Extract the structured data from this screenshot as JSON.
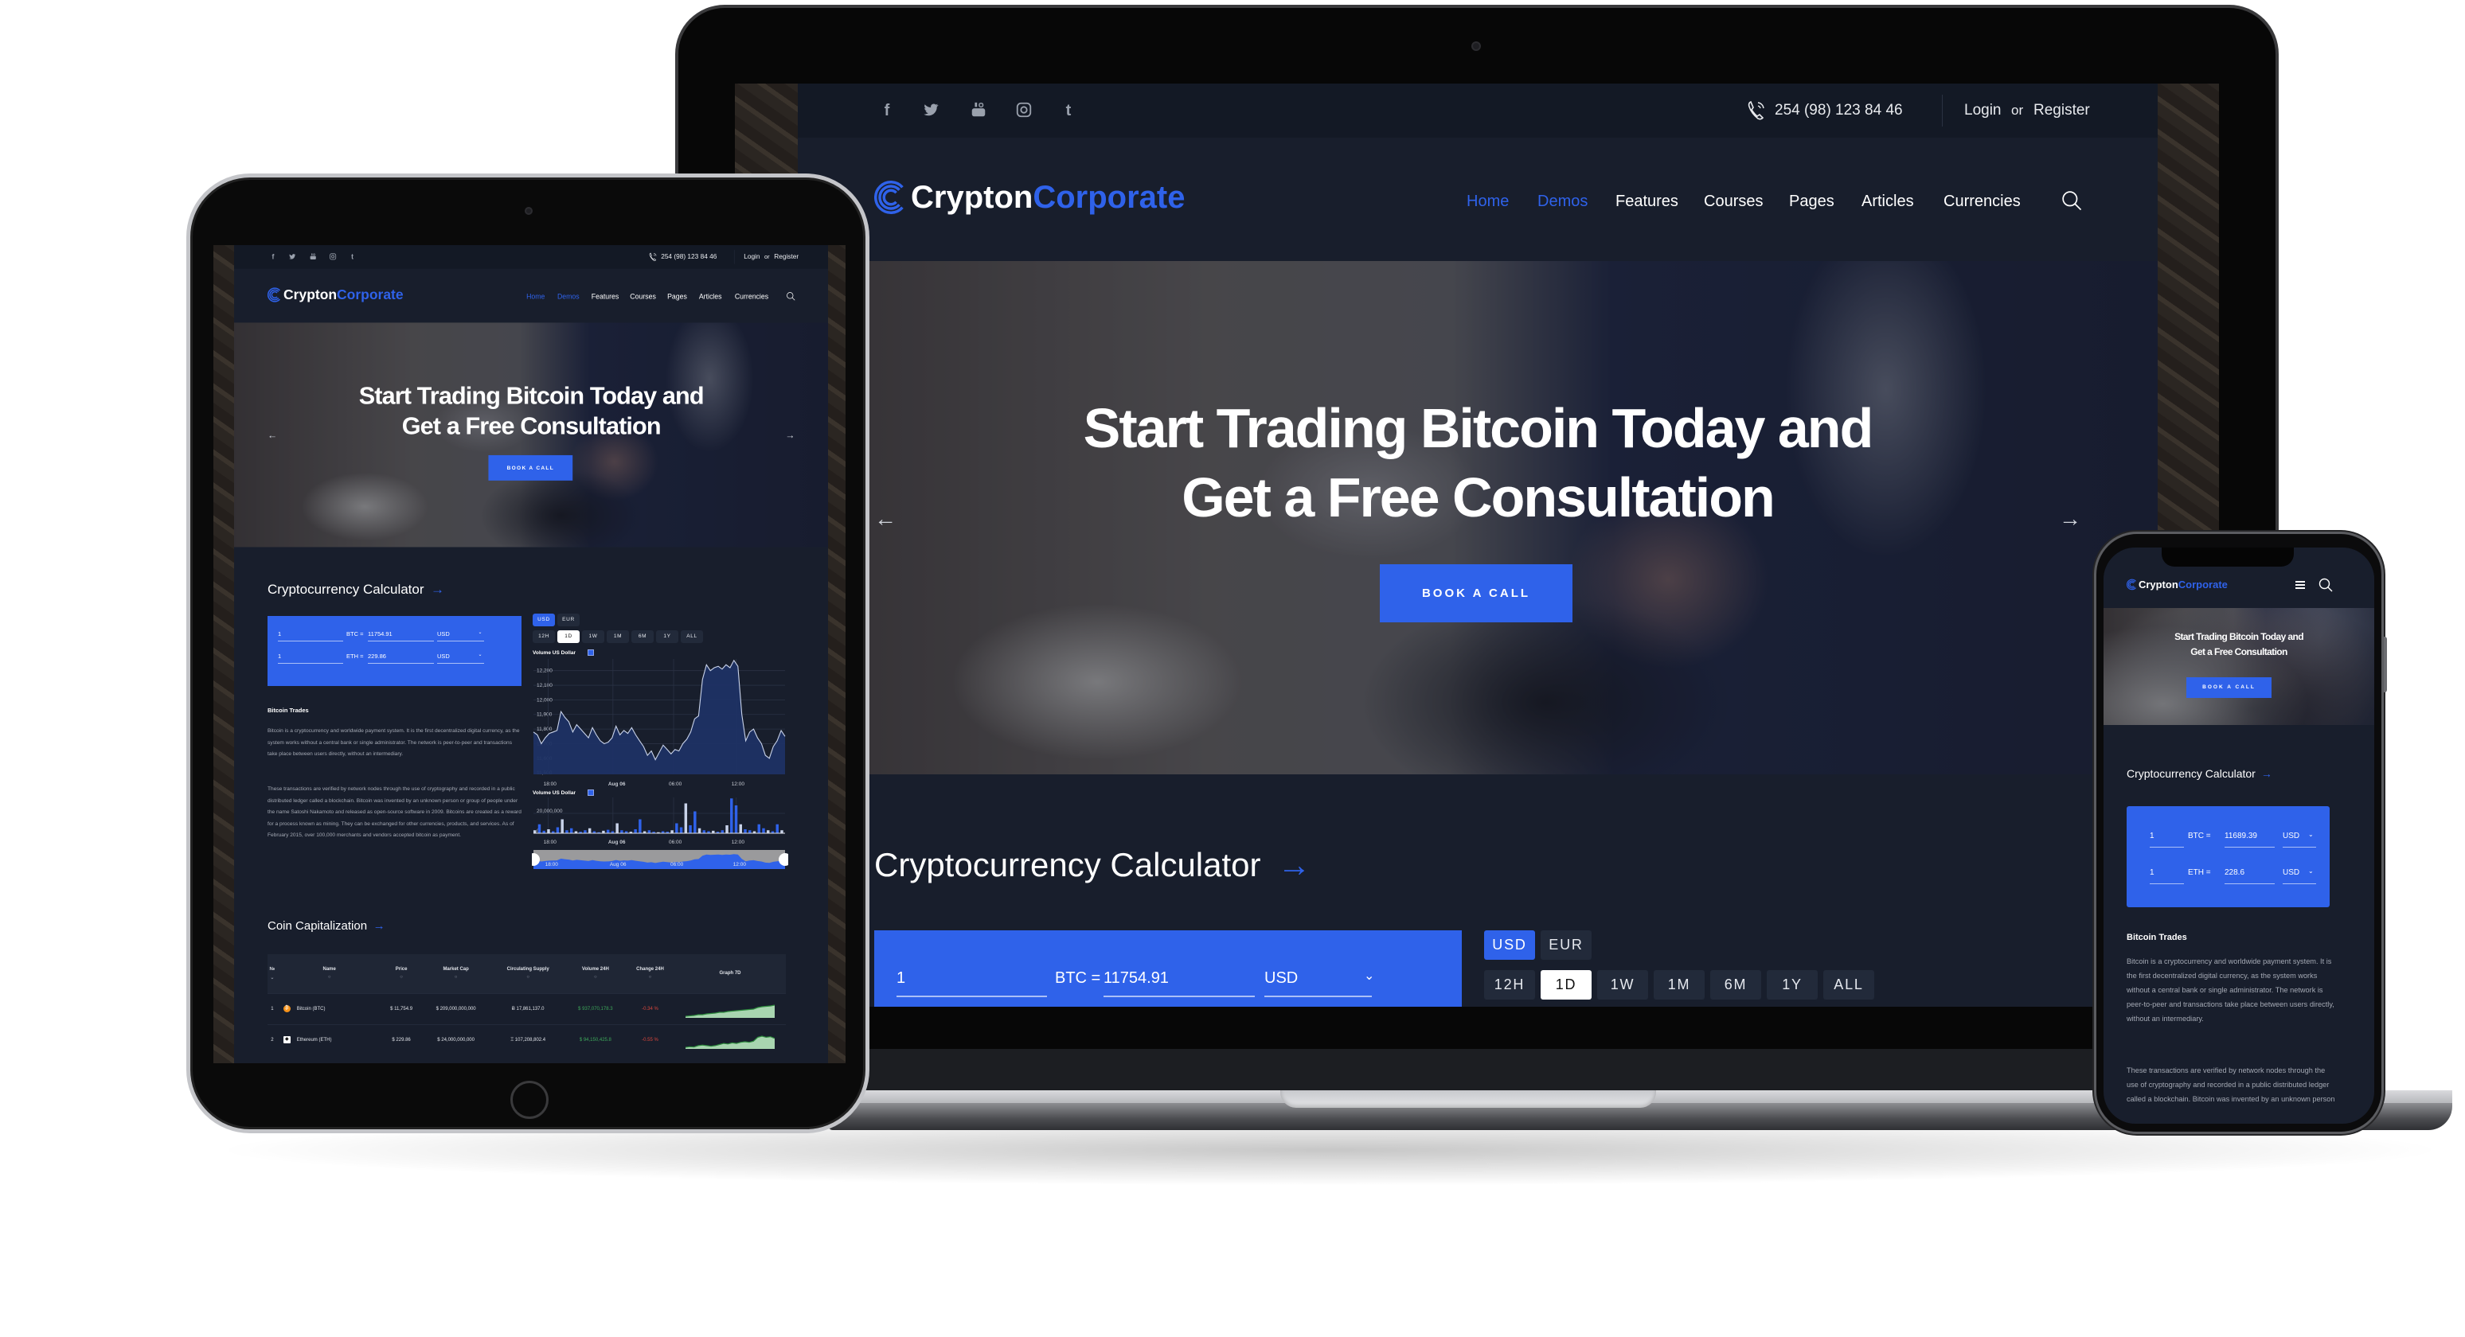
{
  "site": {
    "social": [
      "facebook-icon",
      "twitter-icon",
      "youtube-icon",
      "instagram-icon",
      "tumblr-icon"
    ],
    "phone": "254 (98) 123 84 46",
    "login": "Login",
    "or": "or",
    "register": "Register",
    "logo": {
      "part1": "Crypton",
      "part2": "Corporate"
    },
    "nav": [
      "Home",
      "Demos",
      "Features",
      "Courses",
      "Pages",
      "Articles",
      "Currencies"
    ],
    "nav_active": [
      "Home",
      "Demos"
    ],
    "hero": {
      "line1": "Start Trading Bitcoin Today and",
      "line2": "Get a Free Consultation",
      "button": "BOOK A CALL"
    },
    "calculator": {
      "title": "Cryptocurrency Calculator",
      "arrow": "→",
      "rows": [
        {
          "amount": "1",
          "coin": "BTC =",
          "value": "11754.91",
          "currency": "USD"
        },
        {
          "amount": "1",
          "coin": "ETH =",
          "value": "229.86",
          "currency": "USD"
        }
      ],
      "mobile_rows": [
        {
          "amount": "1",
          "coin": "BTC =",
          "value": "11689.39",
          "currency": "USD"
        },
        {
          "amount": "1",
          "coin": "ETH =",
          "value": "228.6",
          "currency": "USD"
        }
      ],
      "currencies": [
        "USD",
        "EUR"
      ],
      "active_currency": "USD",
      "periods": [
        "12H",
        "1D",
        "1W",
        "1M",
        "6M",
        "1Y",
        "ALL"
      ],
      "active_period": "1D"
    },
    "trades": {
      "title": "Bitcoin Trades",
      "p1": "Bitcoin is a cryptocurrency and worldwide payment system. It is the first decentralized digital currency, as the system works without a central bank or single administrator. The network is peer-to-peer and transactions take place between users directly, without an intermediary.",
      "p2": "These transactions are verified by network nodes through the use of cryptography and recorded in a public distributed ledger called a blockchain. Bitcoin was invented by an unknown person or group of people under the name Satoshi Nakamoto and released as open-source software in 2009. Bitcoins are created as a reward for a process known as mining. They can be exchanged for other currencies, products, and services. As of February 2015, over 100,000 merchants and vendors accepted bitcoin as payment."
    },
    "coin_cap": {
      "title": "Coin Capitalization",
      "headers": [
        "№",
        "Name",
        "Price",
        "Market Cap",
        "Circulating Supply",
        "Volume 24H",
        "Change 24H",
        "Graph 7D"
      ],
      "rows": [
        {
          "rank": "1",
          "name": "Bitcoin (BTC)",
          "icon": "bitcoin-icon",
          "price": "$ 11,754.9",
          "market_cap": "$ 209,000,000,000",
          "supply": "Ƀ 17,861,137.0",
          "volume": "$ 937,070,178.3",
          "change": "-0.34 %"
        },
        {
          "rank": "2",
          "name": "Ethereum (ETH)",
          "icon": "ethereum-icon",
          "price": "$ 229.86",
          "market_cap": "$ 24,000,000,000",
          "supply": "Ξ 107,208,802.4",
          "volume": "$ 94,150,425.8",
          "change": "-0.55 %"
        }
      ]
    }
  },
  "colors": {
    "accent": "#2f62ea",
    "background": "#181e2c",
    "topbar": "#131925",
    "positive": "#3da85a",
    "negative": "#d9463c",
    "spark_fill": "#a8d5b0"
  },
  "chart_data": [
    {
      "type": "area",
      "label": "Volume US Dollar",
      "x_ticks": [
        "18:00",
        "Aug 06",
        "06:00",
        "12:00"
      ],
      "y_ticks": [
        "12,200",
        "12,100",
        "12,000",
        "11,900",
        "11,800",
        "11,700",
        "11,600",
        "11,500"
      ],
      "ylim": [
        11490,
        12280
      ],
      "grid": true,
      "values": [
        11780,
        11760,
        11700,
        11740,
        11770,
        11780,
        11790,
        11920,
        11880,
        11850,
        11780,
        11830,
        11800,
        11770,
        11740,
        11810,
        11760,
        11720,
        11700,
        11710,
        11740,
        11820,
        11760,
        11790,
        11770,
        11810,
        11760,
        11720,
        11680,
        11620,
        11650,
        11590,
        11640,
        11690,
        11660,
        11630,
        11660,
        11650,
        11700,
        11730,
        11780,
        11870,
        11890,
        12140,
        12240,
        12200,
        12220,
        12230,
        12210,
        12240,
        12220,
        12270,
        12230,
        11900,
        11720,
        11780,
        11800,
        11740,
        11700,
        11620,
        11600,
        11680,
        11720,
        11790,
        11750
      ]
    },
    {
      "type": "bar",
      "label": "Volume US Dollar",
      "x_ticks": [
        "18:00",
        "Aug 06",
        "06:00",
        "12:00"
      ],
      "y_ticks": [
        "20,000,000",
        "0"
      ],
      "ylim": [
        0,
        36000000
      ],
      "values": [
        3000000,
        9000000,
        2500000,
        4000000,
        2000000,
        6000000,
        14000000,
        3000000,
        5000000,
        2000000,
        1500000,
        3000000,
        5000000,
        2000000,
        1000000,
        2500000,
        3500000,
        2000000,
        10000000,
        3000000,
        2000000,
        1500000,
        4000000,
        14000000,
        2000000,
        3000000,
        1500000,
        1000000,
        2000000,
        1500000,
        3000000,
        10000000,
        6000000,
        30000000,
        8000000,
        22000000,
        5000000,
        3000000,
        2000000,
        2500000,
        1500000,
        3000000,
        8000000,
        35000000,
        28000000,
        9000000,
        4000000,
        3000000,
        2000000,
        9000000,
        5000000,
        3000000,
        2000000,
        9000000,
        3000000
      ]
    },
    {
      "type": "line",
      "label": "Graph 7D",
      "series": "Bitcoin (BTC)",
      "values": [
        10,
        10.5,
        11,
        12,
        12,
        13,
        13.5,
        14,
        15,
        15,
        16,
        16.5,
        17,
        17.5,
        18,
        18.5,
        19,
        21,
        22,
        22.5,
        23,
        24
      ]
    },
    {
      "type": "line",
      "label": "Graph 7D",
      "series": "Ethereum (ETH)",
      "values": [
        9,
        10,
        9.5,
        12,
        13,
        12,
        11,
        12,
        14,
        16,
        15,
        17,
        16,
        18,
        19,
        18,
        20,
        27,
        29,
        27,
        28,
        25
      ]
    }
  ]
}
